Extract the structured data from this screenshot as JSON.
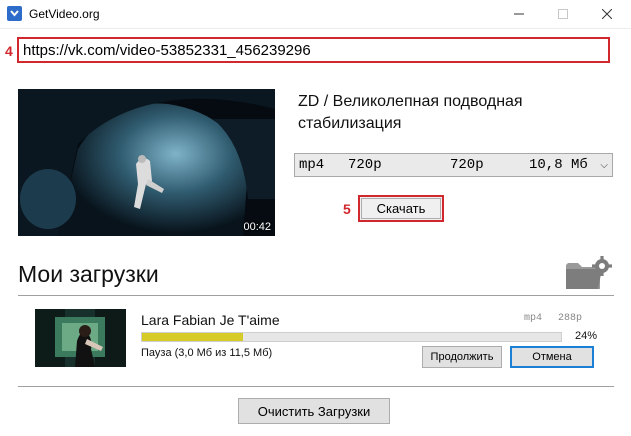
{
  "window": {
    "title": "GetVideo.org",
    "icon": "getvideo-logo-icon",
    "controls": {
      "minimize": "minimize-icon",
      "maximize": "maximize-icon",
      "close": "close-icon"
    }
  },
  "steps": {
    "url": "4",
    "download": "5"
  },
  "url_input": {
    "value": "https://vk.com/video-53852331_456239296"
  },
  "video": {
    "title": "ZD / Великолепная подводная стабилизация",
    "duration": "00:42",
    "format": {
      "container": "mp4",
      "quality": "720p",
      "resolution": "720p",
      "size": "10,8 Мб"
    },
    "download_label": "Скачать"
  },
  "downloads": {
    "title": "Мои загрузки",
    "settings_icon": "folder-settings-icon",
    "items": [
      {
        "title": "Lara Fabian Je T'aime",
        "format": "mp4",
        "resolution": "288p",
        "progress": 0.24,
        "progress_label": "24%",
        "status": "Пауза (3,0 Мб из 11,5 Мб)",
        "continue_label": "Продолжить",
        "cancel_label": "Отмена"
      }
    ],
    "clear_label": "Очистить Загрузки"
  },
  "colors": {
    "highlight": "#d1282e",
    "progress": "#d7cb2a",
    "focus": "#1c7fd6"
  }
}
